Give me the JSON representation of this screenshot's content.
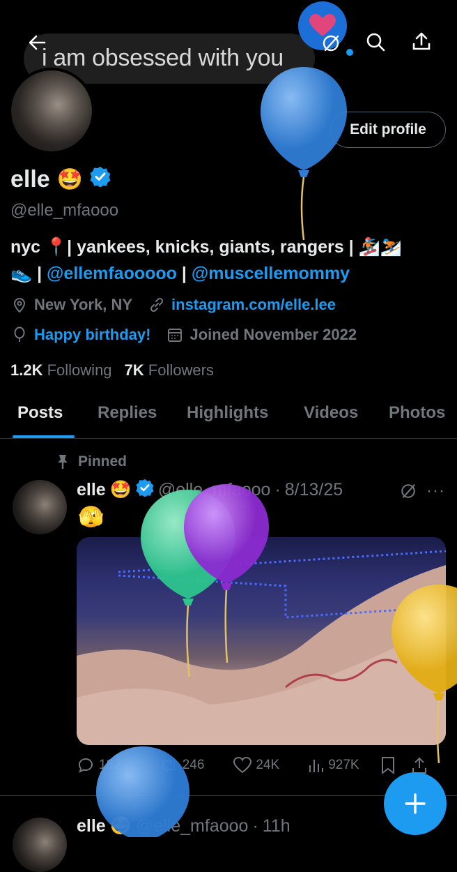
{
  "header": {
    "quote": "i am obsessed with you"
  },
  "profile": {
    "edit_label": "Edit profile",
    "name": "elle",
    "name_emoji": "🤩",
    "handle": "@elle_mfaooo",
    "bio_line1": "nyc 📍| yankees, knicks, giants, rangers | 🏂⛷️",
    "bio_line2_emoji": "👟",
    "bio_mention1": "@ellemfaooooo",
    "bio_sep": "|",
    "bio_mention2": "@muscellemommy",
    "location": "New York, NY",
    "website": "instagram.com/elle.lee",
    "birthday": "Happy birthday!",
    "joined": "Joined November 2022",
    "following_count": "1.2K",
    "following_label": "Following",
    "followers_count": "7K",
    "followers_label": "Followers"
  },
  "tabs": [
    "Posts",
    "Replies",
    "Highlights",
    "Videos",
    "Photos"
  ],
  "pinned_post": {
    "pinned_label": "Pinned",
    "name": "elle",
    "emoji": "🤩",
    "handle": "@elle_mfaooo",
    "dot": "·",
    "date": "8/13/25",
    "text": "🫣",
    "replies": "182",
    "reposts": "246",
    "likes": "24K",
    "views": "927K"
  },
  "next_post": {
    "name": "elle",
    "handle": "@elle_mfaooo",
    "time": "11h"
  },
  "colors": {
    "accent": "#1d9bf0",
    "background": "#000000",
    "balloon_blue": "#3d8fe0",
    "balloon_green": "#3fd9a0",
    "balloon_purple": "#a43be0",
    "balloon_yellow": "#f2c233"
  }
}
